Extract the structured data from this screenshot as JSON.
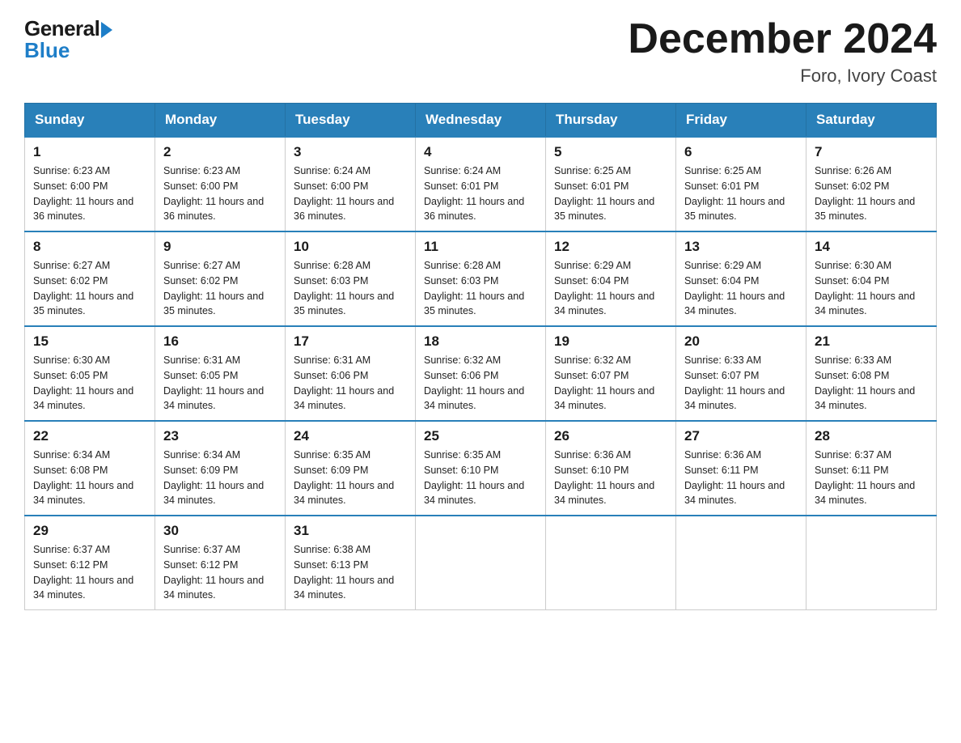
{
  "logo": {
    "general": "General",
    "blue": "Blue"
  },
  "header": {
    "title": "December 2024",
    "subtitle": "Foro, Ivory Coast"
  },
  "days_of_week": [
    "Sunday",
    "Monday",
    "Tuesday",
    "Wednesday",
    "Thursday",
    "Friday",
    "Saturday"
  ],
  "weeks": [
    [
      {
        "day": "1",
        "sunrise": "6:23 AM",
        "sunset": "6:00 PM",
        "daylight": "11 hours and 36 minutes."
      },
      {
        "day": "2",
        "sunrise": "6:23 AM",
        "sunset": "6:00 PM",
        "daylight": "11 hours and 36 minutes."
      },
      {
        "day": "3",
        "sunrise": "6:24 AM",
        "sunset": "6:00 PM",
        "daylight": "11 hours and 36 minutes."
      },
      {
        "day": "4",
        "sunrise": "6:24 AM",
        "sunset": "6:01 PM",
        "daylight": "11 hours and 36 minutes."
      },
      {
        "day": "5",
        "sunrise": "6:25 AM",
        "sunset": "6:01 PM",
        "daylight": "11 hours and 35 minutes."
      },
      {
        "day": "6",
        "sunrise": "6:25 AM",
        "sunset": "6:01 PM",
        "daylight": "11 hours and 35 minutes."
      },
      {
        "day": "7",
        "sunrise": "6:26 AM",
        "sunset": "6:02 PM",
        "daylight": "11 hours and 35 minutes."
      }
    ],
    [
      {
        "day": "8",
        "sunrise": "6:27 AM",
        "sunset": "6:02 PM",
        "daylight": "11 hours and 35 minutes."
      },
      {
        "day": "9",
        "sunrise": "6:27 AM",
        "sunset": "6:02 PM",
        "daylight": "11 hours and 35 minutes."
      },
      {
        "day": "10",
        "sunrise": "6:28 AM",
        "sunset": "6:03 PM",
        "daylight": "11 hours and 35 minutes."
      },
      {
        "day": "11",
        "sunrise": "6:28 AM",
        "sunset": "6:03 PM",
        "daylight": "11 hours and 35 minutes."
      },
      {
        "day": "12",
        "sunrise": "6:29 AM",
        "sunset": "6:04 PM",
        "daylight": "11 hours and 34 minutes."
      },
      {
        "day": "13",
        "sunrise": "6:29 AM",
        "sunset": "6:04 PM",
        "daylight": "11 hours and 34 minutes."
      },
      {
        "day": "14",
        "sunrise": "6:30 AM",
        "sunset": "6:04 PM",
        "daylight": "11 hours and 34 minutes."
      }
    ],
    [
      {
        "day": "15",
        "sunrise": "6:30 AM",
        "sunset": "6:05 PM",
        "daylight": "11 hours and 34 minutes."
      },
      {
        "day": "16",
        "sunrise": "6:31 AM",
        "sunset": "6:05 PM",
        "daylight": "11 hours and 34 minutes."
      },
      {
        "day": "17",
        "sunrise": "6:31 AM",
        "sunset": "6:06 PM",
        "daylight": "11 hours and 34 minutes."
      },
      {
        "day": "18",
        "sunrise": "6:32 AM",
        "sunset": "6:06 PM",
        "daylight": "11 hours and 34 minutes."
      },
      {
        "day": "19",
        "sunrise": "6:32 AM",
        "sunset": "6:07 PM",
        "daylight": "11 hours and 34 minutes."
      },
      {
        "day": "20",
        "sunrise": "6:33 AM",
        "sunset": "6:07 PM",
        "daylight": "11 hours and 34 minutes."
      },
      {
        "day": "21",
        "sunrise": "6:33 AM",
        "sunset": "6:08 PM",
        "daylight": "11 hours and 34 minutes."
      }
    ],
    [
      {
        "day": "22",
        "sunrise": "6:34 AM",
        "sunset": "6:08 PM",
        "daylight": "11 hours and 34 minutes."
      },
      {
        "day": "23",
        "sunrise": "6:34 AM",
        "sunset": "6:09 PM",
        "daylight": "11 hours and 34 minutes."
      },
      {
        "day": "24",
        "sunrise": "6:35 AM",
        "sunset": "6:09 PM",
        "daylight": "11 hours and 34 minutes."
      },
      {
        "day": "25",
        "sunrise": "6:35 AM",
        "sunset": "6:10 PM",
        "daylight": "11 hours and 34 minutes."
      },
      {
        "day": "26",
        "sunrise": "6:36 AM",
        "sunset": "6:10 PM",
        "daylight": "11 hours and 34 minutes."
      },
      {
        "day": "27",
        "sunrise": "6:36 AM",
        "sunset": "6:11 PM",
        "daylight": "11 hours and 34 minutes."
      },
      {
        "day": "28",
        "sunrise": "6:37 AM",
        "sunset": "6:11 PM",
        "daylight": "11 hours and 34 minutes."
      }
    ],
    [
      {
        "day": "29",
        "sunrise": "6:37 AM",
        "sunset": "6:12 PM",
        "daylight": "11 hours and 34 minutes."
      },
      {
        "day": "30",
        "sunrise": "6:37 AM",
        "sunset": "6:12 PM",
        "daylight": "11 hours and 34 minutes."
      },
      {
        "day": "31",
        "sunrise": "6:38 AM",
        "sunset": "6:13 PM",
        "daylight": "11 hours and 34 minutes."
      },
      null,
      null,
      null,
      null
    ]
  ]
}
